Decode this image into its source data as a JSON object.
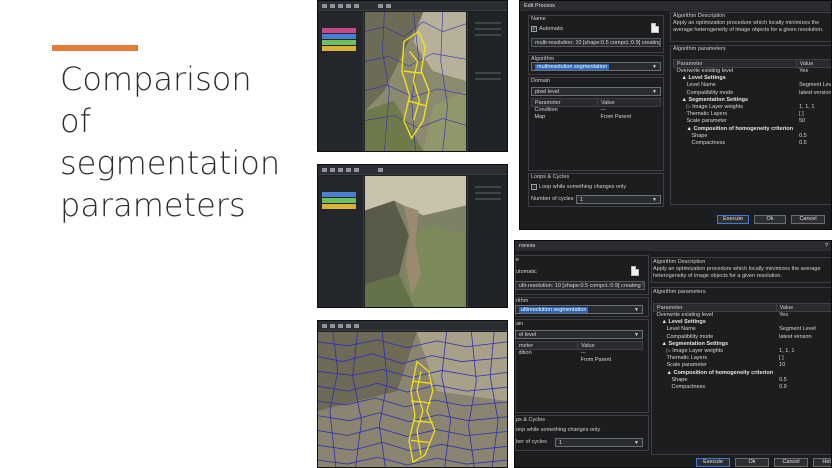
{
  "slide": {
    "title_lines": [
      "Comparison",
      "of",
      "segmentation",
      "parameters"
    ],
    "accent_color": "#e07b39"
  },
  "dialog1": {
    "title": "Edit Process",
    "name_label": "Name",
    "automatic_label": "Automatic",
    "automatic_checked": true,
    "name_value": "multi-resolution: 10 [shape:0.5 compct.:0.9] creating 'Seg",
    "algorithm_label": "Algorithm",
    "algorithm_value": "multiresolution segmentation",
    "domain_label": "Domain",
    "domain_value": "pixel level",
    "domain_headers": [
      "Parameter",
      "Value"
    ],
    "domain_rows": [
      [
        "Condition",
        "---"
      ],
      [
        "Map",
        "From Parent"
      ]
    ],
    "loops_label": "Loops & Cycles",
    "loop_label": "Loop while something changes only",
    "cycles_label": "Number of cycles",
    "cycles_value": "1",
    "algo_desc_label": "Algorithm Description",
    "algo_desc_text": "Apply an optimization procedure which locally minimizes the average heterogeneity of image objects for a given resolution.",
    "algo_params_label": "Algorithm parameters",
    "params_headers": [
      "Parameter",
      "Value"
    ],
    "params": [
      {
        "name": "Overwrite existing level",
        "value": "Yes",
        "indent": 0,
        "section": false
      },
      {
        "name": "▲ Level Settings",
        "value": "",
        "indent": 1,
        "section": true
      },
      {
        "name": "Level Name",
        "value": "Segment Level",
        "indent": 2,
        "section": false
      },
      {
        "name": "Compatibility mode",
        "value": "latest version",
        "indent": 2,
        "section": false
      },
      {
        "name": "▲ Segmentation Settings",
        "value": "",
        "indent": 1,
        "section": true
      },
      {
        "name": "▷ Image Layer weights",
        "value": "1, 1, 1",
        "indent": 2,
        "section": false
      },
      {
        "name": "Thematic Layers",
        "value": "[ ]",
        "indent": 2,
        "section": false
      },
      {
        "name": "Scale parameter",
        "value": "50",
        "indent": 2,
        "section": false
      },
      {
        "name": "▲ Composition of homogeneity criterion",
        "value": "",
        "indent": 2,
        "section": true
      },
      {
        "name": "Shape",
        "value": "0.5",
        "indent": 3,
        "section": false
      },
      {
        "name": "Compactness",
        "value": "0.5",
        "indent": 3,
        "section": false
      }
    ],
    "buttons": {
      "execute": "Execute",
      "ok": "Ok",
      "cancel": "Cancel"
    }
  },
  "dialog2": {
    "title": "rocess",
    "help_glyph": "?",
    "name_label": "e",
    "automatic_label": "utomatic",
    "name_value": "ulti-resolution: 10 [shape:0.5 compct.:0.9] creating 'Seg",
    "algorithm_label": "rithm",
    "algorithm_value": "ultiresolution segmentation",
    "domain_label": "ain",
    "domain_value": "el level",
    "domain_headers": [
      "meter",
      "Value"
    ],
    "domain_rows": [
      [
        "dition",
        "---"
      ],
      [
        "",
        "From Parent"
      ]
    ],
    "loops_label": "ps & Cycles",
    "loop_label": "oop while something changes only",
    "cycles_label": "ber of cycles",
    "cycles_value": "1",
    "algo_desc_label": "Algorithm Description",
    "algo_desc_text": "Apply an optimization procedure which locally minimizes the average heterogeneity of image objects for a given resolution.",
    "algo_params_label": "Algorithm parameters",
    "params_headers": [
      "Parameter",
      "Value"
    ],
    "params": [
      {
        "name": "Overwrite existing level",
        "value": "Yes",
        "indent": 0,
        "section": false
      },
      {
        "name": "▲ Level Settings",
        "value": "",
        "indent": 1,
        "section": true
      },
      {
        "name": "Level Name",
        "value": "Segment Level",
        "indent": 2,
        "section": false
      },
      {
        "name": "Compatibility mode",
        "value": "latest version",
        "indent": 2,
        "section": false
      },
      {
        "name": "▲ Segmentation Settings",
        "value": "",
        "indent": 1,
        "section": true
      },
      {
        "name": "▷ Image Layer weights",
        "value": "1, 1, 1",
        "indent": 2,
        "section": false
      },
      {
        "name": "Thematic Layers",
        "value": "[ ]",
        "indent": 2,
        "section": false
      },
      {
        "name": "Scale parameter",
        "value": "10",
        "indent": 2,
        "section": false
      },
      {
        "name": "▲ Composition of homogeneity criterion",
        "value": "",
        "indent": 2,
        "section": true
      },
      {
        "name": "Shape",
        "value": "0.5",
        "indent": 3,
        "section": false
      },
      {
        "name": "Compactness",
        "value": "0.9",
        "indent": 3,
        "section": false
      }
    ],
    "buttons": {
      "execute": "Execute",
      "ok": "Ok",
      "cancel": "Cancel",
      "help": "Help"
    }
  },
  "colors": {
    "segment_outline": "#f2e21c",
    "object_outline": "#2a2fb4",
    "dialog_bg": "#1c1d1f",
    "selection_blue": "#2e66b8"
  }
}
